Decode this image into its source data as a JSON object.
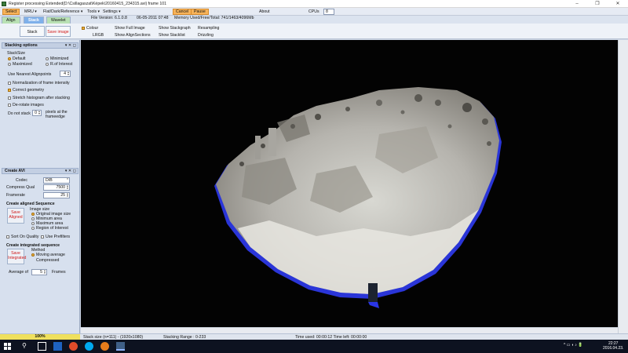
{
  "window": {
    "title": "Register processing Extended(D:\\Csillagaszat\\Képek\\20160415_234315.avi) frame 101",
    "buttons": {
      "minimize": "–",
      "maximize": "❐",
      "close": "✕"
    }
  },
  "menubar": {
    "items": [
      "Select",
      "MRU ▾",
      "Flat/Dark/Reference ▾",
      "Tools ▾",
      "Settings ▾"
    ],
    "cancel": "Cancel",
    "pause": "Pause",
    "about": "About",
    "cpus_label": "CPUs",
    "cpus_value": "8",
    "file_version": "File Version: 6.1.0.8",
    "date": "06-05-2011 07:48",
    "memory": "Memory Used/Free/Total: 741/1463/4096Mb"
  },
  "tabs": [
    "Align",
    "Stack",
    "Wavelet"
  ],
  "toolbar": {
    "stack": "Stack",
    "save_image": "Save image",
    "colour": "Colour",
    "lrgb": "LRGB",
    "show_full_image": "Show Full Image",
    "show_alignsections": "Show AlignSections",
    "show_stackgraph": "Show Stackgraph",
    "show_stacklist": "Show Stacklist",
    "resampling": "Resampling",
    "drizzling": "Drizzling"
  },
  "stacking": {
    "header": "Stacking options",
    "stacksize": "StackSize",
    "default": "Default",
    "minimized": "Minimized",
    "maximized": "Maximized",
    "roi": "R.of Interest",
    "use_nearest": "Use Nearest",
    "alignpoints": "Alignpoints",
    "alignpoints_value": "4",
    "normalization": "Normalization of frame intensity",
    "correct_geometry": "Correct geometry",
    "stretch": "Stretch histogram after stacking",
    "derotate": "De-rotate images",
    "do_not_stack": "Do not stack",
    "do_not_stack_value": "0",
    "pixels_at": "pixels at the",
    "frameedge": "frameedge"
  },
  "avi": {
    "header": "Create AVI",
    "codec_label": "Codec",
    "codec_value": "DIB",
    "compress_label": "Compress Qual",
    "compress_value": "7500",
    "framerate_label": "Framerate",
    "framerate_value": "25",
    "aligned_title": "Create aligned Sequence",
    "save_aligned": "Save Aligned",
    "image_size": "Image size",
    "orig_size": "Original image size",
    "min_area": "Minimum area",
    "max_area": "Maximum area",
    "roi": "Region of Interest",
    "sort_quality": "Sort On Quality",
    "use_prefilters": "Use Prefilters",
    "integrated_title": "Create integrated sequence",
    "save_integrated": "Save Integrated",
    "method": "Method",
    "moving_average": "Moving average",
    "compressed": "Compressed",
    "average_of": "Average of",
    "average_value": "5",
    "frames": "Frames"
  },
  "status": {
    "progress": 1.0,
    "progress_label": "100%",
    "stack_size": "Stack size (n=111) - (1920x1080)",
    "stacking_range": "Stacking Range : 0-233",
    "time": "Time used: 00:00:12 Time left: 00:00:00"
  },
  "taskbar": {
    "clock": "22:27",
    "date": "2016.04.23."
  },
  "colors": {
    "orange": "#f7b35a",
    "red_text": "#d01818",
    "tab_active": "#7fb0ea",
    "progress": "#efe05d"
  }
}
